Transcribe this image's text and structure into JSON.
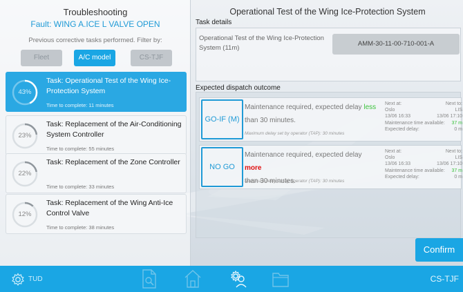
{
  "left": {
    "title": "Troubleshooting",
    "fault_prefix": "Fault:",
    "fault_code": "WING A.ICE L VALVE OPEN",
    "filter_text": "Previous corrective tasks performed. Filter by:",
    "filters": [
      {
        "label": "Fleet",
        "active": false
      },
      {
        "label": "A/C model",
        "active": true
      },
      {
        "label": "CS-TJF",
        "active": false
      }
    ],
    "tasks": [
      {
        "percent": "43%",
        "progress": 0.43,
        "title": "Task: Operational Test of the Wing Ice-Protection System",
        "time": "Time to complete: 11 minutes",
        "active": true
      },
      {
        "percent": "23%",
        "progress": 0.23,
        "title": "Task: Replacement of the Air-Conditioning System Controller",
        "time": "Time to complete: 55 minutes",
        "active": false
      },
      {
        "percent": "22%",
        "progress": 0.22,
        "title": "Task: Replacement of the Zone Controller",
        "time": "Time to complete: 33 minutes",
        "active": false
      },
      {
        "percent": "12%",
        "progress": 0.12,
        "title": "Task: Replacement of the Wing Anti-Ice Control Valve",
        "time": "Time to complete: 38 minutes",
        "active": false
      }
    ]
  },
  "right": {
    "title": "Operational Test of the Wing Ice-Protection System",
    "task_details_label": "Task details",
    "task_details_text": "Operational Test of the Wing Ice-Protection System (11m)",
    "amm_ref": "AMM-30-11-00-710-001-A",
    "dispatch_label": "Expected dispatch outcome",
    "outcomes": [
      {
        "badge": "GO-IF (M)",
        "text_before": "Maintenance required, expected delay ",
        "emphasis": "less",
        "text_after": " than 30 minutes.",
        "note": "Maximum delay set by operator (TAP): 30 minutes",
        "next_at_label": "Next at:",
        "next_at_city": "Oslo",
        "next_at_time": "13/06 16:33",
        "next_to_label": "Next to:",
        "next_to_city": "LIS",
        "next_to_time": "13/06 17:10",
        "maint_label": "Maintenance time available:",
        "maint_value": "37 m",
        "delay_label": "Expected delay:",
        "delay_value": "0 m"
      },
      {
        "badge": "NO GO",
        "text_before": "Maintenance required, expected delay ",
        "emphasis": "more",
        "text_after": " than 30 minutes.",
        "note": "Maximum delay set by operator (TAP): 30 minutes",
        "next_at_label": "Next at:",
        "next_at_city": "Oslo",
        "next_at_time": "13/06 16:33",
        "next_to_label": "Next to:",
        "next_to_city": "LIS",
        "next_to_time": "13/06 17:10",
        "maint_label": "Maintenance time available:",
        "maint_value": "37 m",
        "delay_label": "Expected delay:",
        "delay_value": "0 m"
      }
    ],
    "confirm_label": "Confirm"
  },
  "bottom": {
    "user": "TUD",
    "aircraft": "CS-TJF",
    "icons": [
      "settings-icon",
      "document-search-icon",
      "home-icon",
      "technician-icon",
      "folder-icon"
    ]
  },
  "colors": {
    "accent": "#1aa6e4",
    "less": "#3cc23c",
    "more": "#e01010"
  }
}
